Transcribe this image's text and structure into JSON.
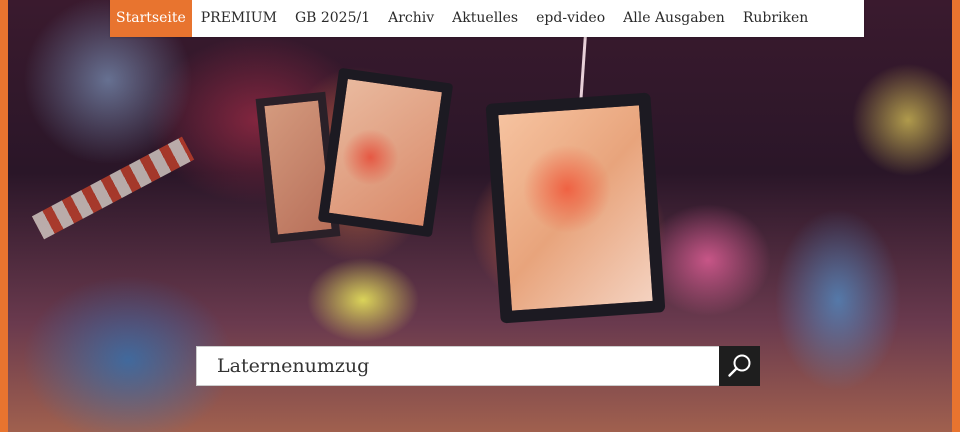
{
  "nav": {
    "items": [
      {
        "label": "Startseite",
        "active": true
      },
      {
        "label": "PREMIUM"
      },
      {
        "label": "GB 2025/1"
      },
      {
        "label": "Archiv"
      },
      {
        "label": "Aktuelles"
      },
      {
        "label": "epd-video"
      },
      {
        "label": "Alle Ausgaben"
      },
      {
        "label": "Rubriken"
      }
    ]
  },
  "search": {
    "value": "Laternenumzug",
    "icon": "search-icon"
  },
  "colors": {
    "accent": "#e8742f",
    "button": "#1e1e1e"
  }
}
